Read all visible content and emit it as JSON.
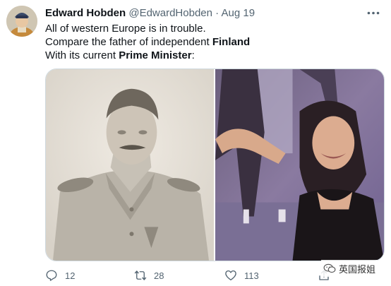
{
  "tweet": {
    "author_name": "Edward Hobden",
    "handle": "@EdwardHobden",
    "separator": "·",
    "date": "Aug 19",
    "lines": [
      {
        "before": "All of western Europe is in trouble.",
        "bold": "",
        "after": ""
      },
      {
        "before": "Compare the father of independent ",
        "bold": "Finland",
        "after": ""
      },
      {
        "before": "With its current ",
        "bold": "Prime Minister",
        "after": ":"
      }
    ]
  },
  "actions": {
    "reply_count": "12",
    "retweet_count": "28",
    "like_count": "113"
  },
  "watermark": {
    "text": "英国报姐"
  },
  "icons": {
    "more": "more-dots-icon",
    "reply": "reply-icon",
    "retweet": "retweet-icon",
    "like": "heart-icon",
    "share": "share-icon"
  },
  "colors": {
    "text_primary": "#0f1419",
    "text_secondary": "#536471",
    "border": "#cfd9de"
  }
}
